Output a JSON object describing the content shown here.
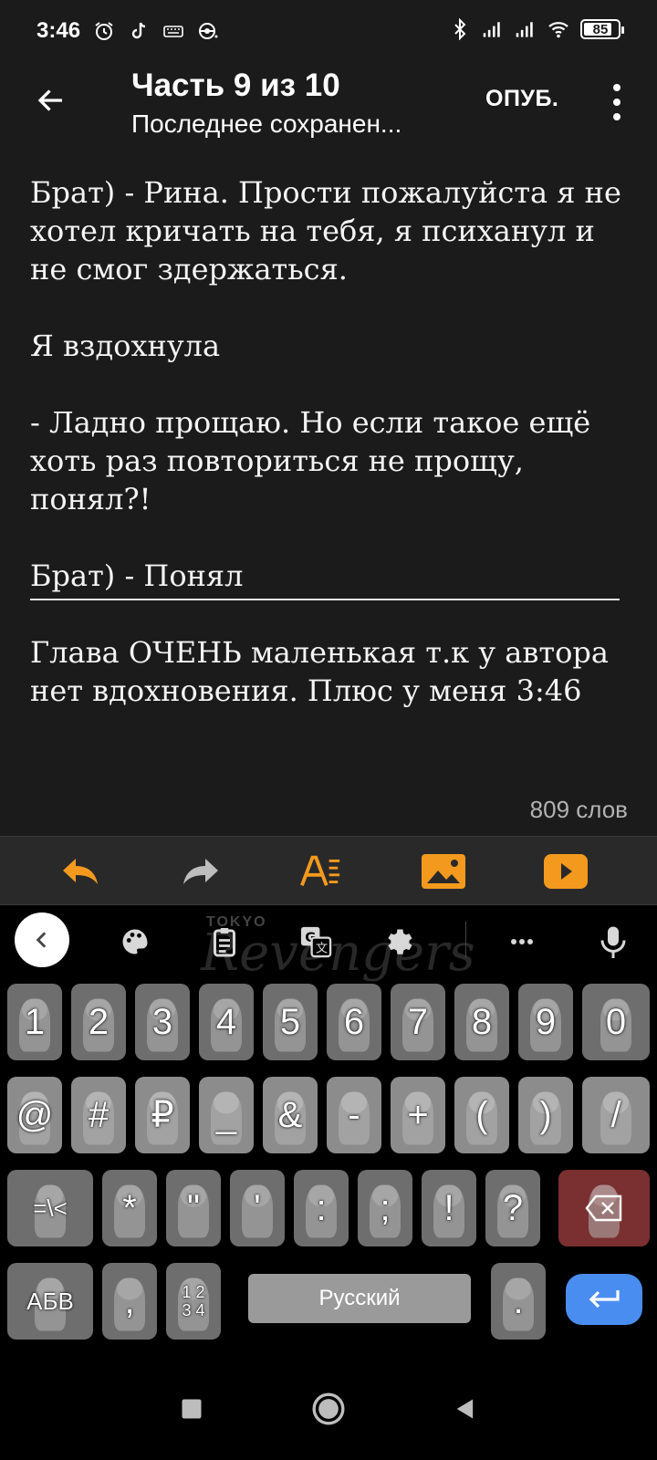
{
  "status_bar": {
    "time": "3:46",
    "battery_level": "85",
    "icons": [
      "alarm-icon",
      "tiktok-icon",
      "keyboard-icon",
      "pokeball-icon",
      "bluetooth-icon",
      "signal-icon",
      "signal-icon",
      "wifi-icon",
      "battery-icon"
    ]
  },
  "app_bar": {
    "title": "Часть 9 из 10",
    "subtitle": "Последнее сохранен...",
    "publish_label": "ОПУБ."
  },
  "editor": {
    "paragraphs": [
      "Брат) - Рина. Прости пожалуйста я не хотел кричать на тебя, я психанул и не смог здержаться.",
      "",
      "Я вздохнула",
      "",
      "- Ладно прощаю. Но если такое ещё хоть раз повториться не прощу, понял?!",
      "",
      "Брат) - Понял"
    ],
    "after_divider": "Глава ОЧЕНЬ маленькая т.к у автора нет вдохновения. Плюс у меня 3:46",
    "word_count": "809 слов"
  },
  "format_toolbar": {
    "accent_color": "#f39a1e",
    "buttons": [
      "undo-icon",
      "redo-icon",
      "text-format-icon",
      "insert-image-icon",
      "insert-video-icon"
    ]
  },
  "keyboard": {
    "theme_text_small": "TOKYO",
    "theme_text": "Revengers",
    "tools": [
      "collapse-icon",
      "palette-icon",
      "clipboard-icon",
      "translate-icon",
      "settings-icon",
      "more-icon",
      "microphone-icon"
    ],
    "row1": [
      "1",
      "2",
      "3",
      "4",
      "5",
      "6",
      "7",
      "8",
      "9",
      "0"
    ],
    "row2": [
      "@",
      "#",
      "₽",
      "_",
      "&",
      "-",
      "+",
      "(",
      ")",
      "/"
    ],
    "row3": [
      "=\\<",
      "*",
      "\"",
      "'",
      ":",
      ";",
      "!",
      "?"
    ],
    "abc_label": "АБВ",
    "comma": ",",
    "numpad_label_top": "1 2",
    "numpad_label_bottom": "3 4",
    "space_label": "Русский",
    "period": "."
  },
  "nav_bar": {
    "buttons": [
      "recents-icon",
      "home-icon",
      "back-icon"
    ]
  }
}
